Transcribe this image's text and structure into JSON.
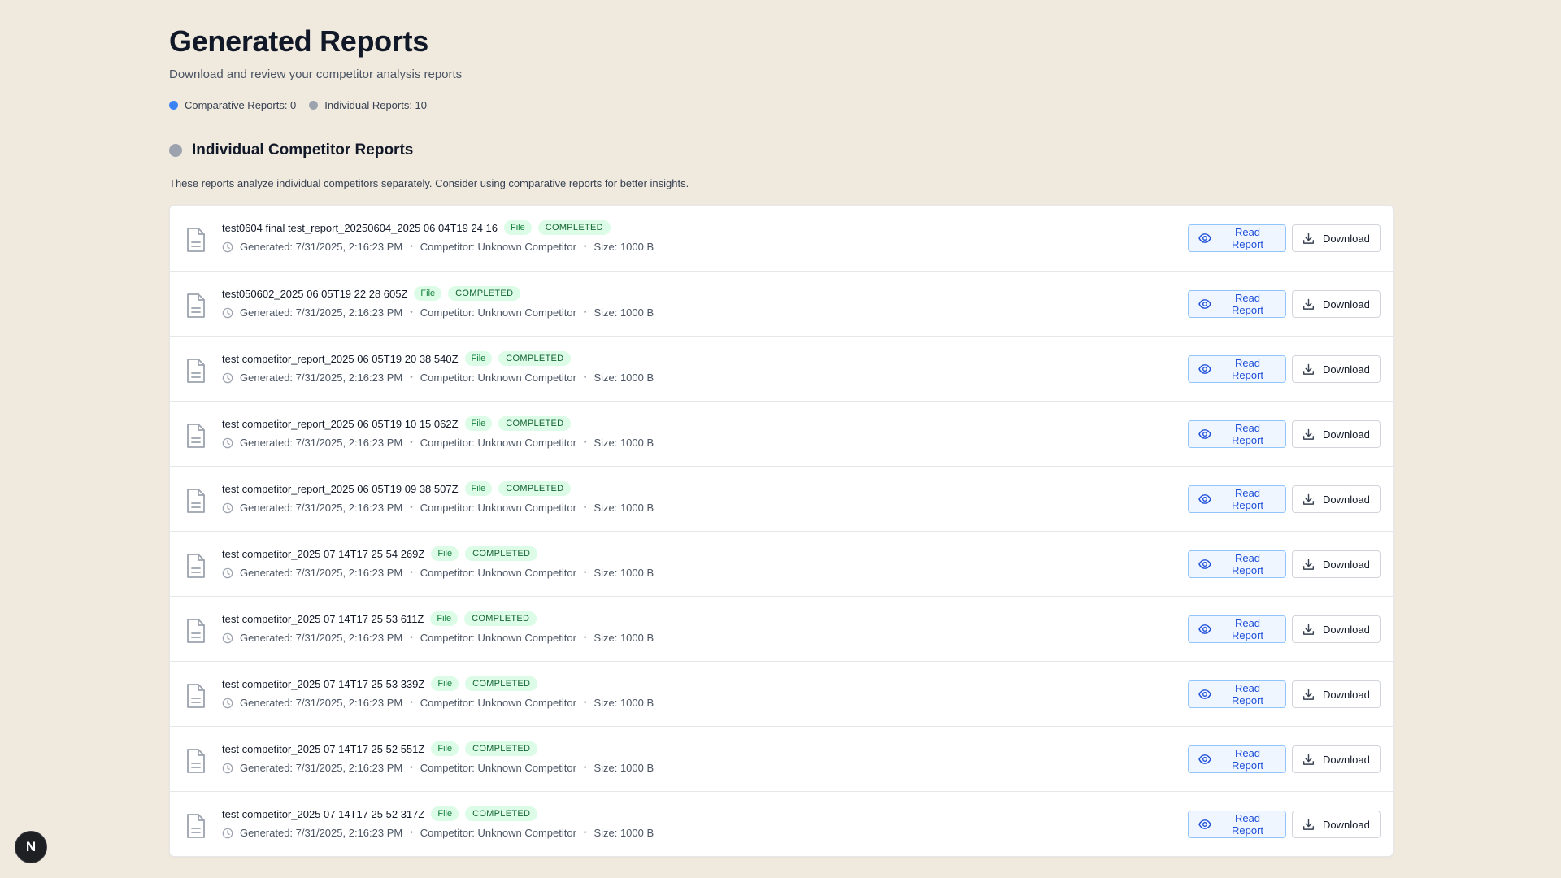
{
  "page": {
    "title": "Generated Reports",
    "subtitle": "Download and review your competitor analysis reports"
  },
  "stats": {
    "comparative": "Comparative Reports: 0",
    "individual": "Individual Reports: 10",
    "comparative_color": "#3b82f6",
    "individual_color": "#9ca3af"
  },
  "section": {
    "title": "Individual Competitor Reports",
    "description": "These reports analyze individual competitors separately. Consider using comparative reports for better insights."
  },
  "labels": {
    "read_report": "Read Report",
    "download": "Download"
  },
  "reports": [
    {
      "name": "test0604 final test_report_20250604_2025 06 04T19 24 16",
      "type": "File",
      "status": "COMPLETED",
      "generated": "Generated: 7/31/2025, 2:16:23 PM",
      "competitor": "Competitor: Unknown Competitor",
      "size": "Size: 1000 B"
    },
    {
      "name": "test050602_2025 06 05T19 22 28 605Z",
      "type": "File",
      "status": "COMPLETED",
      "generated": "Generated: 7/31/2025, 2:16:23 PM",
      "competitor": "Competitor: Unknown Competitor",
      "size": "Size: 1000 B"
    },
    {
      "name": "test competitor_report_2025 06 05T19 20 38 540Z",
      "type": "File",
      "status": "COMPLETED",
      "generated": "Generated: 7/31/2025, 2:16:23 PM",
      "competitor": "Competitor: Unknown Competitor",
      "size": "Size: 1000 B"
    },
    {
      "name": "test competitor_report_2025 06 05T19 10 15 062Z",
      "type": "File",
      "status": "COMPLETED",
      "generated": "Generated: 7/31/2025, 2:16:23 PM",
      "competitor": "Competitor: Unknown Competitor",
      "size": "Size: 1000 B"
    },
    {
      "name": "test competitor_report_2025 06 05T19 09 38 507Z",
      "type": "File",
      "status": "COMPLETED",
      "generated": "Generated: 7/31/2025, 2:16:23 PM",
      "competitor": "Competitor: Unknown Competitor",
      "size": "Size: 1000 B"
    },
    {
      "name": "test competitor_2025 07 14T17 25 54 269Z",
      "type": "File",
      "status": "COMPLETED",
      "generated": "Generated: 7/31/2025, 2:16:23 PM",
      "competitor": "Competitor: Unknown Competitor",
      "size": "Size: 1000 B"
    },
    {
      "name": "test competitor_2025 07 14T17 25 53 611Z",
      "type": "File",
      "status": "COMPLETED",
      "generated": "Generated: 7/31/2025, 2:16:23 PM",
      "competitor": "Competitor: Unknown Competitor",
      "size": "Size: 1000 B"
    },
    {
      "name": "test competitor_2025 07 14T17 25 53 339Z",
      "type": "File",
      "status": "COMPLETED",
      "generated": "Generated: 7/31/2025, 2:16:23 PM",
      "competitor": "Competitor: Unknown Competitor",
      "size": "Size: 1000 B"
    },
    {
      "name": "test competitor_2025 07 14T17 25 52 551Z",
      "type": "File",
      "status": "COMPLETED",
      "generated": "Generated: 7/31/2025, 2:16:23 PM",
      "competitor": "Competitor: Unknown Competitor",
      "size": "Size: 1000 B"
    },
    {
      "name": "test competitor_2025 07 14T17 25 52 317Z",
      "type": "File",
      "status": "COMPLETED",
      "generated": "Generated: 7/31/2025, 2:16:23 PM",
      "competitor": "Competitor: Unknown Competitor",
      "size": "Size: 1000 B"
    }
  ],
  "avatar": {
    "letter": "N"
  },
  "icons": {
    "file": "file-text-icon",
    "clock": "clock-icon",
    "eye": "eye-icon",
    "download": "download-icon",
    "separator": "•"
  }
}
